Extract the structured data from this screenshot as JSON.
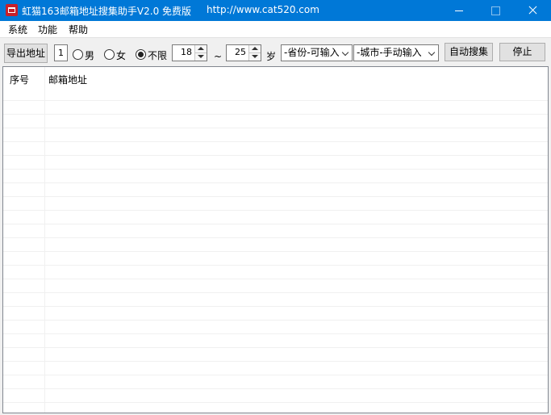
{
  "window": {
    "title": "虹猫163邮箱地址搜集助手V2.0 免费版",
    "url": "http://www.cat520.com"
  },
  "menu": [
    "系统",
    "功能",
    "帮助"
  ],
  "toolbar": {
    "export_label": "导出地址",
    "page_value": "1",
    "gender_options": [
      "男",
      "女",
      "不限"
    ],
    "gender_selected": "不限",
    "age_min": "18",
    "age_sep": "~",
    "age_max": "25",
    "age_unit": "岁",
    "province": "-省份-可输入",
    "city": "-城市-手动输入",
    "search_label": "自动搜集",
    "stop_label": "停止"
  },
  "list": {
    "columns": [
      "序号",
      "邮箱地址"
    ],
    "rows": []
  }
}
